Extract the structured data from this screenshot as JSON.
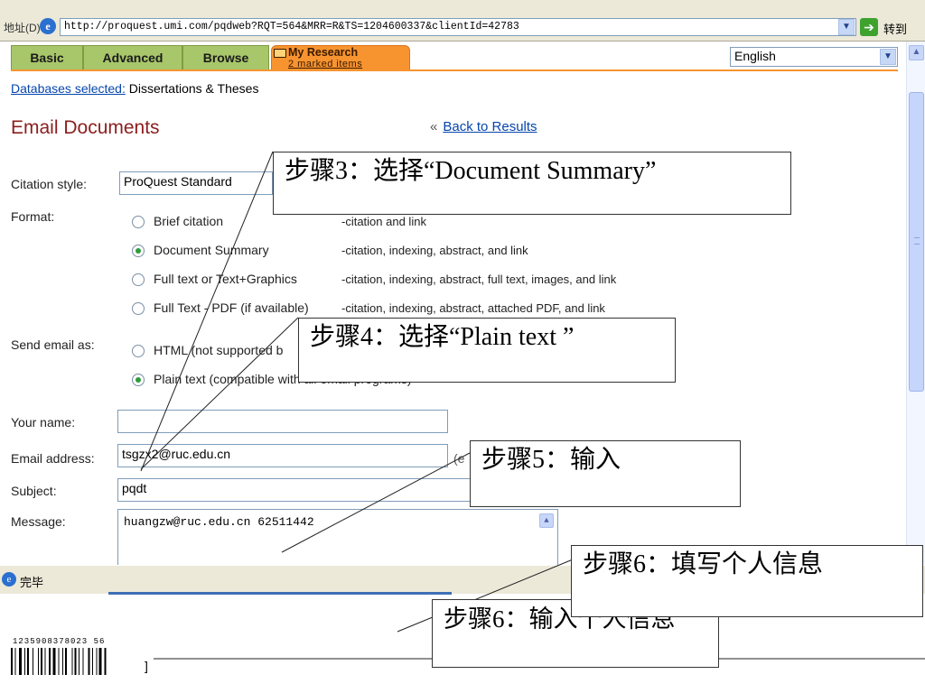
{
  "browser": {
    "address_label": "地址(D)",
    "url": "http://proquest.umi.com/pqdweb?RQT=564&MRR=R&TS=1204600337&clientId=42783",
    "go_label": "转到",
    "status": "完毕"
  },
  "tabs": [
    "Basic",
    "Advanced",
    "Browse"
  ],
  "my_research": {
    "title": "My Research",
    "sub": "2 marked items"
  },
  "language": "English",
  "databases": {
    "label": "Databases selected:",
    "value": "Dissertations & Theses"
  },
  "page": {
    "title": "Email Documents",
    "back": "Back to Results",
    "back_prefix": "«"
  },
  "form": {
    "citation_label": "Citation style:",
    "citation_value": "ProQuest Standard",
    "format_label": "Format:",
    "formats": [
      {
        "label": "Brief citation",
        "desc": "-citation and link"
      },
      {
        "label": "Document Summary",
        "desc": "-citation, indexing, abstract, and link"
      },
      {
        "label": "Full text or Text+Graphics",
        "desc": "-citation, indexing, abstract, full text, images, and link"
      },
      {
        "label": "Full Text - PDF (if available)",
        "desc": "-citation, indexing, abstract, attached PDF, and link"
      }
    ],
    "send_label": "Send email as:",
    "send_options": [
      "HTML (not supported b",
      "Plain text (compatible with all email programs)"
    ],
    "name_label": "Your name:",
    "name_value": "",
    "email_label": "Email address:",
    "email_value": "tsgzx2@ruc.edu.cn",
    "email_hint": "(e",
    "subject_label": "Subject:",
    "subject_value": "pqdt",
    "message_label": "Message:",
    "message_value": "huangzw@ruc.edu.cn  62511442"
  },
  "notes": {
    "step3": "步骤3：选择“Document Summary”",
    "step4": "步骤4：选择“Plain text ”",
    "step5": "步骤5：输入",
    "step6": "步骤6：填写个人信息",
    "step6b": "步骤6：输入个人信息"
  },
  "barcode_number": "1235908378023 56"
}
